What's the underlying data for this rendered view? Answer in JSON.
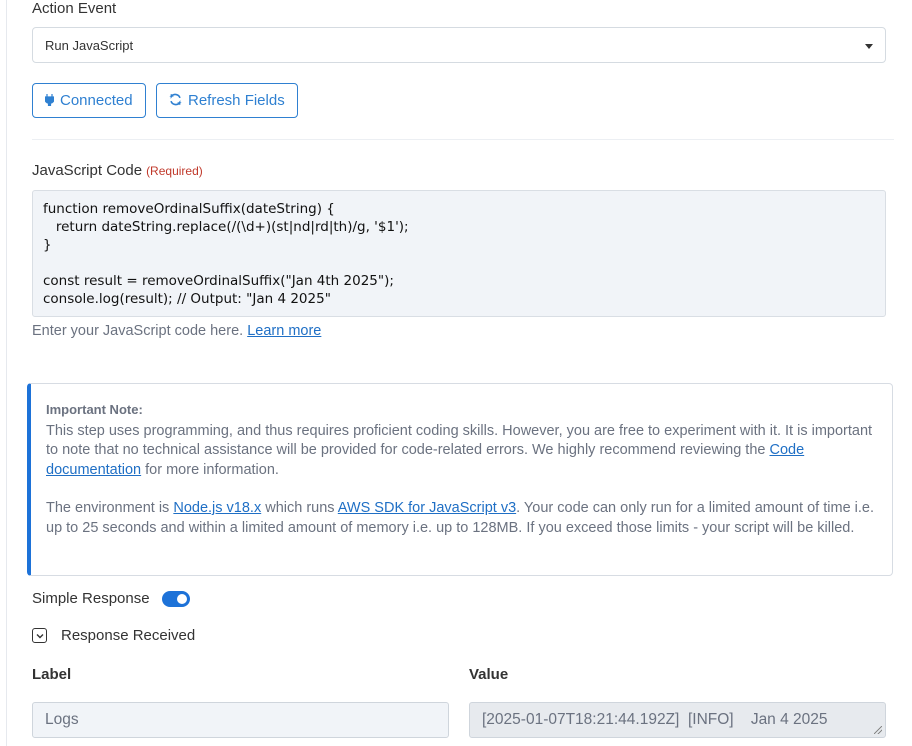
{
  "action_event": {
    "label": "Action Event",
    "selected": "Run JavaScript"
  },
  "buttons": {
    "connected": "Connected",
    "refresh": "Refresh Fields"
  },
  "code_field": {
    "label": "JavaScript Code",
    "required": "(Required)",
    "code": "function removeOrdinalSuffix(dateString) {\n   return dateString.replace(/(\\d+)(st|nd|rd|th)/g, '$1');\n}\n\nconst result = removeOrdinalSuffix(\"Jan 4th 2025\");\nconsole.log(result); // Output: \"Jan 4 2025\"",
    "hint": "Enter your JavaScript code here.",
    "hint_link": "Learn more"
  },
  "note": {
    "title": "Important Note:",
    "p1_a": "This step uses programming, and thus requires proficient coding skills. However, you are free to experiment with it. It is important to note that no technical assistance will be provided for code-related errors. We highly recommend reviewing the ",
    "p1_link": "Code documentation",
    "p1_b": " for more information.",
    "p2_a": "The environment is ",
    "p2_link1": "Node.js v18.x",
    "p2_b": " which runs ",
    "p2_link2": "AWS SDK for JavaScript v3",
    "p2_c": ". Your code can only run for a limited amount of time i.e. up to 25 seconds and within a limited amount of memory i.e. up to 128MB. If you exceed those limits - your script will be killed."
  },
  "simple_response": {
    "label": "Simple Response",
    "enabled": true
  },
  "response_received": {
    "label": "Response Received",
    "expanded": true
  },
  "table": {
    "label_header": "Label",
    "value_header": "Value",
    "rows": [
      {
        "label": "Logs",
        "value": "[2025-01-07T18:21:44.192Z]  [INFO]    Jan 4 2025"
      }
    ]
  },
  "colors": {
    "accent": "#1d72d8",
    "required": "#c0392b",
    "link": "#1f6fc5"
  }
}
